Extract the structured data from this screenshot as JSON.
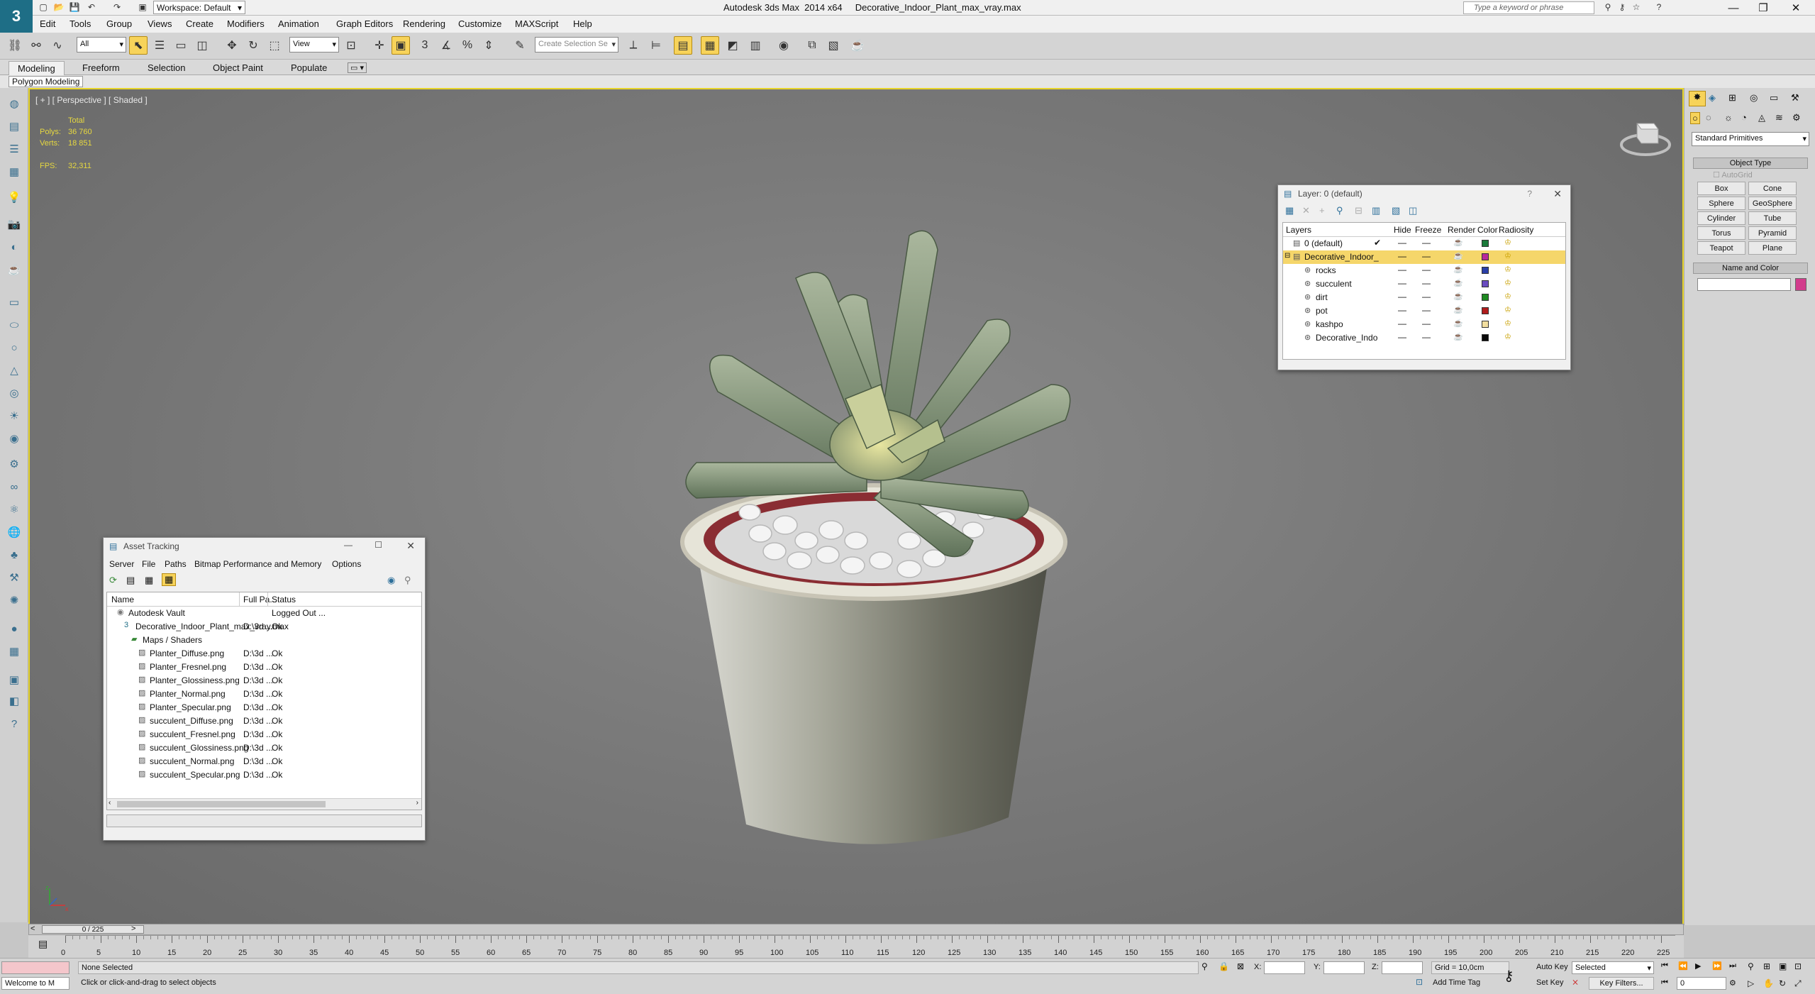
{
  "title_bar": {
    "logo": "3",
    "workspace": "Workspace: Default",
    "app_title": "Autodesk 3ds Max  2014 x64     Decorative_Indoor_Plant_max_vray.max",
    "help_placeholder": "Type a keyword or phrase"
  },
  "menu": [
    "Edit",
    "Tools",
    "Group",
    "Views",
    "Create",
    "Modifiers",
    "Animation",
    "Graph Editors",
    "Rendering",
    "Customize",
    "MAXScript",
    "Help"
  ],
  "toolbar": {
    "filter_select": "All",
    "ref_coord": "View",
    "named_selection_placeholder": "Create Selection Se"
  },
  "ribbon": {
    "tabs": [
      "Modeling",
      "Freeform",
      "Selection",
      "Object Paint",
      "Populate"
    ],
    "sub_label": "Polygon Modeling"
  },
  "viewport": {
    "label": "[ + ] [ Perspective ] [ Shaded ]",
    "stats_header": "Total",
    "polys_label": "Polys:",
    "polys_value": "36 760",
    "verts_label": "Verts:",
    "verts_value": "18 851",
    "fps_label": "FPS:",
    "fps_value": "32,311"
  },
  "layer_window": {
    "title": "Layer: 0 (default)",
    "columns": [
      "Layers",
      "Hide",
      "Freeze",
      "Render",
      "Color",
      "Radiosity"
    ],
    "rows": [
      {
        "name": "0 (default)",
        "color": "#1a7a3a",
        "indent": 0
      },
      {
        "name": "Decorative_Indoor_",
        "color": "#b8299a",
        "indent": 0
      },
      {
        "name": "rocks",
        "color": "#2a3fa8",
        "indent": 1
      },
      {
        "name": "succulent",
        "color": "#6a4cc0",
        "indent": 1
      },
      {
        "name": "dirt",
        "color": "#1e8a22",
        "indent": 1
      },
      {
        "name": "pot",
        "color": "#b01c1c",
        "indent": 1
      },
      {
        "name": "kashpo",
        "color": "#f2dea0",
        "indent": 1
      },
      {
        "name": "Decorative_Indo",
        "color": "#0a0a0a",
        "indent": 1
      }
    ]
  },
  "asset_window": {
    "title": "Asset Tracking",
    "menu": [
      "Server",
      "File",
      "Paths",
      "Bitmap Performance and Memory",
      "Options"
    ],
    "columns": [
      "Name",
      "Full Pa...",
      "Status"
    ],
    "rows": [
      {
        "name": "Autodesk Vault",
        "path": "",
        "status": "Logged Out ...",
        "indent": 1
      },
      {
        "name": "Decorative_Indoor_Plant_max_vray.max",
        "path": "D:\\3d ...",
        "status": "Ok",
        "indent": 2
      },
      {
        "name": "Maps / Shaders",
        "path": "",
        "status": "",
        "indent": 3
      },
      {
        "name": "Planter_Diffuse.png",
        "path": "D:\\3d ...",
        "status": "Ok",
        "indent": 4
      },
      {
        "name": "Planter_Fresnel.png",
        "path": "D:\\3d ...",
        "status": "Ok",
        "indent": 4
      },
      {
        "name": "Planter_Glossiness.png",
        "path": "D:\\3d ...",
        "status": "Ok",
        "indent": 4
      },
      {
        "name": "Planter_Normal.png",
        "path": "D:\\3d ...",
        "status": "Ok",
        "indent": 4
      },
      {
        "name": "Planter_Specular.png",
        "path": "D:\\3d ...",
        "status": "Ok",
        "indent": 4
      },
      {
        "name": "succulent_Diffuse.png",
        "path": "D:\\3d ...",
        "status": "Ok",
        "indent": 4
      },
      {
        "name": "succulent_Fresnel.png",
        "path": "D:\\3d ...",
        "status": "Ok",
        "indent": 4
      },
      {
        "name": "succulent_Glossiness.png",
        "path": "D:\\3d ...",
        "status": "Ok",
        "indent": 4
      },
      {
        "name": "succulent_Normal.png",
        "path": "D:\\3d ...",
        "status": "Ok",
        "indent": 4
      },
      {
        "name": "succulent_Specular.png",
        "path": "D:\\3d ...",
        "status": "Ok",
        "indent": 4
      }
    ]
  },
  "command_panel": {
    "category": "Standard Primitives",
    "object_type_title": "Object Type",
    "autogrid": "AutoGrid",
    "buttons": [
      "Box",
      "Cone",
      "Sphere",
      "GeoSphere",
      "Cylinder",
      "Tube",
      "Torus",
      "Pyramid",
      "Teapot",
      "Plane"
    ],
    "name_color_title": "Name and Color",
    "object_color": "#d23c8c"
  },
  "timeline": {
    "frame_label": "0 / 225",
    "ticks": [
      "0",
      "5",
      "10",
      "15",
      "20",
      "25",
      "30",
      "35",
      "40",
      "45",
      "50",
      "55",
      "60",
      "65",
      "70",
      "75",
      "80",
      "85",
      "90",
      "95",
      "100",
      "105",
      "110",
      "115",
      "120",
      "125",
      "130",
      "135",
      "140",
      "145",
      "150",
      "155",
      "160",
      "165",
      "170",
      "175",
      "180",
      "185",
      "190",
      "195",
      "200",
      "205",
      "210",
      "215",
      "220",
      "225"
    ]
  },
  "status_bar": {
    "maxscript": "Welcome to M",
    "selection": "None Selected",
    "prompt": "Click or click-and-drag to select objects",
    "x_label": "X:",
    "y_label": "Y:",
    "z_label": "Z:",
    "grid": "Grid = 10,0cm",
    "add_time_tag": "Add Time Tag",
    "auto_key": "Auto Key",
    "set_key": "Set Key",
    "selected_dropdown": "Selected",
    "key_filters": "Key Filters...",
    "current_frame": "0"
  }
}
